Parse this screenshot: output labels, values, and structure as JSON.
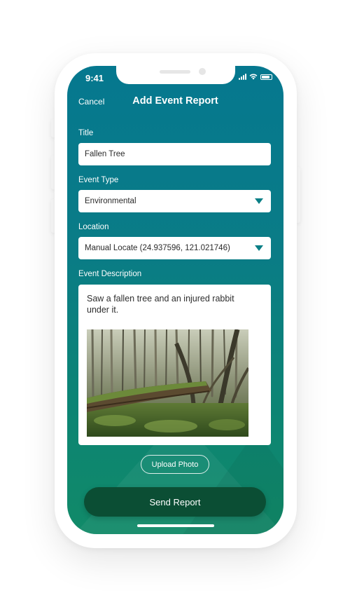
{
  "status_bar": {
    "time": "9:41"
  },
  "nav": {
    "cancel_label": "Cancel",
    "title": "Add Event Report"
  },
  "form": {
    "title": {
      "label": "Title",
      "value": "Fallen Tree"
    },
    "event_type": {
      "label": "Event Type",
      "value": "Environmental"
    },
    "location": {
      "label": "Location",
      "value": "Manual Locate (24.937596, 121.021746)"
    },
    "description": {
      "label": "Event Description",
      "text": "Saw a fallen tree and an injured rabbit under it.",
      "photo": "fallen-tree-forest-photo"
    }
  },
  "actions": {
    "upload_label": "Upload Photo",
    "send_label": "Send Report"
  },
  "icons": [
    "cellular-signal-icon",
    "wifi-icon",
    "battery-icon",
    "chevron-down-icon"
  ],
  "colors": {
    "screen_top": "#05788f",
    "screen_bottom": "#118a68",
    "caret": "#0a7f86",
    "send_button": "#0b4e34"
  }
}
